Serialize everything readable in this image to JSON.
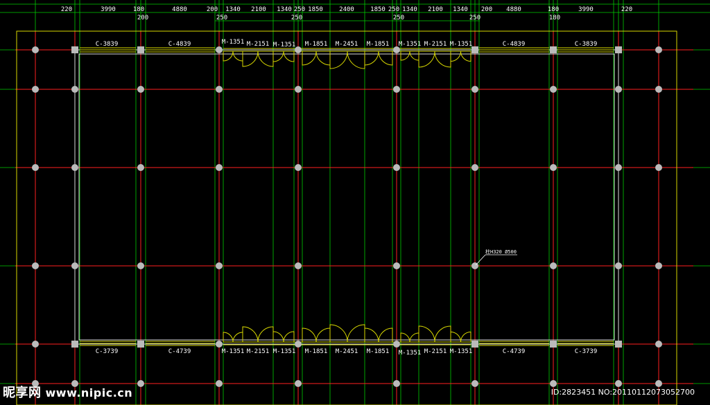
{
  "colors": {
    "background": "#000000",
    "axis_grid": "#ff2020",
    "dimension_lines": "#00cc00",
    "walls": "#d8d800",
    "columns": "#bbbbbb",
    "text": "#ffffff"
  },
  "dimensions": {
    "top_row1": [
      "220",
      "3990",
      "180",
      "4880",
      "200",
      "1340",
      "2100",
      "1340",
      "250",
      "1850",
      "2400",
      "1850",
      "250",
      "1340",
      "2100",
      "1340",
      "200",
      "4880",
      "180",
      "3990",
      "220"
    ],
    "top_row2": [
      "200",
      "250",
      "250",
      "250",
      "250",
      "180"
    ]
  },
  "openings": {
    "top": [
      "C-3839",
      "C-4839",
      "M-1351",
      "M-2151",
      "M-1351",
      "M-1851",
      "M-2451",
      "M-1851",
      "M-1351",
      "M-2151",
      "M-1351",
      "C-4839",
      "C-3839"
    ],
    "bottom": [
      "C-3739",
      "C-4739",
      "M-1351",
      "M-2151",
      "M-1351",
      "M-1851",
      "M-2451",
      "M-1851",
      "M-1351",
      "M-2151",
      "M-1351",
      "C-4739",
      "C-3739"
    ]
  },
  "annotation": {
    "column_note": "柱H320 Ø500"
  },
  "watermark": {
    "brand": "昵享网",
    "url": "www.nipic.cn",
    "id_text": "ID:2823451 NO:20110112073052700"
  }
}
